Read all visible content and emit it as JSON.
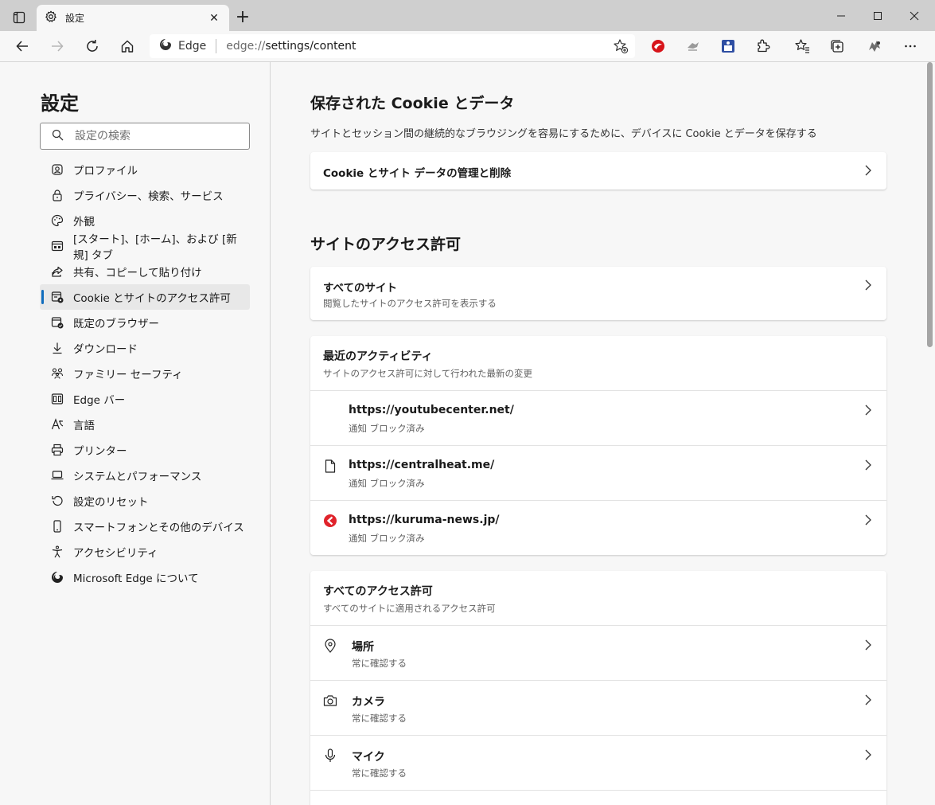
{
  "tab": {
    "title": "設定",
    "close": "✕",
    "new_tab": "+"
  },
  "address": {
    "identity": "Edge",
    "url_scheme": "edge://",
    "url_path": "settings/content"
  },
  "sidebar": {
    "title": "設定",
    "search_placeholder": "設定の検索",
    "items": [
      {
        "label": "プロファイル",
        "icon": "profile-icon"
      },
      {
        "label": "プライバシー、検索、サービス",
        "icon": "lock-icon"
      },
      {
        "label": "外観",
        "icon": "palette-icon"
      },
      {
        "label": "[スタート]、[ホーム]、および [新規] タブ",
        "icon": "newtab-icon"
      },
      {
        "label": "共有、コピーして貼り付け",
        "icon": "share-icon"
      },
      {
        "label": "Cookie とサイトのアクセス許可",
        "icon": "site-permissions-icon",
        "active": true
      },
      {
        "label": "既定のブラウザー",
        "icon": "browser-check-icon"
      },
      {
        "label": "ダウンロード",
        "icon": "download-icon"
      },
      {
        "label": "ファミリー セーフティ",
        "icon": "family-icon"
      },
      {
        "label": "Edge バー",
        "icon": "edge-bar-icon"
      },
      {
        "label": "言語",
        "icon": "language-icon"
      },
      {
        "label": "プリンター",
        "icon": "printer-icon"
      },
      {
        "label": "システムとパフォーマンス",
        "icon": "laptop-icon"
      },
      {
        "label": "設定のリセット",
        "icon": "reset-icon"
      },
      {
        "label": "スマートフォンとその他のデバイス",
        "icon": "phone-icon"
      },
      {
        "label": "アクセシビリティ",
        "icon": "accessibility-icon"
      },
      {
        "label": "Microsoft Edge について",
        "icon": "edge-logo-icon"
      }
    ]
  },
  "main": {
    "cookies": {
      "heading": "保存された Cookie とデータ",
      "description": "サイトとセッション間の継続的なブラウジングを容易にするために、デバイスに Cookie とデータを保存する",
      "manage_label": "Cookie とサイト データの管理と削除"
    },
    "permissions": {
      "heading": "サイトのアクセス許可",
      "all_sites": {
        "title": "すべてのサイト",
        "subtitle": "閲覧したサイトのアクセス許可を表示する"
      },
      "recent": {
        "title": "最近のアクティビティ",
        "subtitle": "サイトのアクセス許可に対して行われた最新の変更",
        "sites": [
          {
            "url": "https://youtubecenter.net/",
            "status": "通知 ブロック済み",
            "icon": "blank-favicon"
          },
          {
            "url": "https://centralheat.me/",
            "status": "通知 ブロック済み",
            "icon": "document-icon"
          },
          {
            "url": "https://kuruma-news.jp/",
            "status": "通知 ブロック済み",
            "icon": "kuruma-news-favicon"
          }
        ]
      },
      "all_permissions": {
        "title": "すべてのアクセス許可",
        "subtitle": "すべてのサイトに適用されるアクセス許可",
        "items": [
          {
            "title": "場所",
            "subtitle": "常に確認する",
            "icon": "location-icon"
          },
          {
            "title": "カメラ",
            "subtitle": "常に確認する",
            "icon": "camera-icon"
          },
          {
            "title": "マイク",
            "subtitle": "常に確認する",
            "icon": "microphone-icon"
          }
        ]
      }
    }
  },
  "colors": {
    "accent": "#0f6cbd",
    "background": "#f7f7f7",
    "tabbar": "#cfcfcf"
  }
}
